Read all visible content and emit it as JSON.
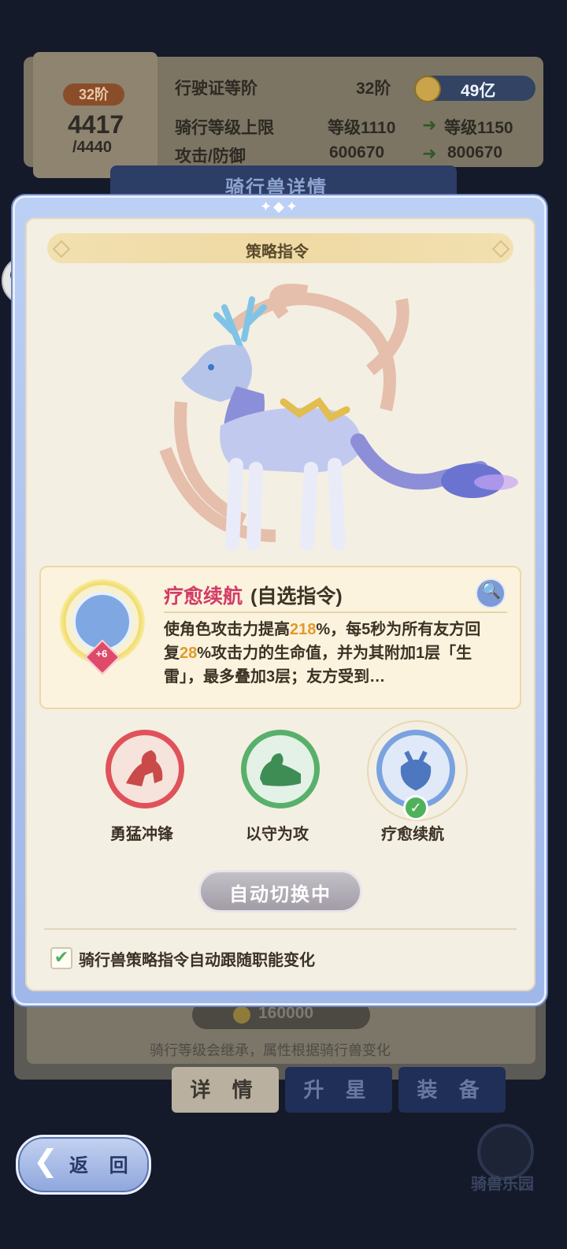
{
  "background": {
    "pass_rank_badge": "32阶",
    "progress_current": "4417",
    "progress_total": "/4440",
    "rows": [
      {
        "label": "行驶证等阶",
        "value": "32阶",
        "next": ""
      },
      {
        "label": "骑行等级上限",
        "value": "等级1110",
        "next": "等级1150"
      },
      {
        "label": "攻击/防御",
        "value": "600670",
        "next": "800670"
      }
    ],
    "currency": "49亿",
    "window_title": "骑行兽详情",
    "price": "160000",
    "note": "骑行等级会继承，属性根据骑行兽变化",
    "tabs": {
      "detail": "详 情",
      "star": "升 星",
      "equip": "装 备"
    },
    "back_label": "返 回",
    "park_label": "骑兽乐园"
  },
  "modal": {
    "section_title": "策略指令",
    "skill": {
      "name": "疗愈续航",
      "type": "(自选指令)",
      "level_badge": "+6",
      "desc_parts": [
        {
          "t": "使角色攻击力提高",
          "h": false
        },
        {
          "t": "218",
          "h": true
        },
        {
          "t": "%，每5秒为所有友方回复",
          "h": false
        },
        {
          "t": "28",
          "h": true
        },
        {
          "t": "%攻击力的生命值，并为其附加1层「生雷」，最多叠加3层；友方受到…",
          "h": false
        }
      ]
    },
    "options": [
      {
        "label": "勇猛冲锋",
        "selected": false,
        "color": "#e0525a"
      },
      {
        "label": "以守为攻",
        "selected": false,
        "color": "#58b06a"
      },
      {
        "label": "疗愈续航",
        "selected": true,
        "color": "#7aa2df"
      }
    ],
    "auto_button": "自动切换中",
    "auto_follow": {
      "label": "骑行兽策略指令自动跟随职能变化",
      "checked": true
    }
  }
}
